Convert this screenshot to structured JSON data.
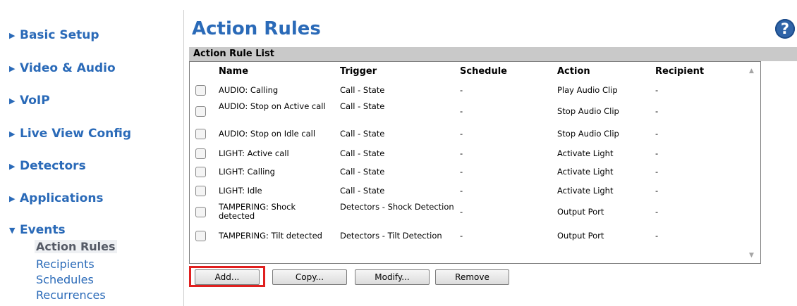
{
  "sidebar": {
    "items": [
      {
        "label": "Basic Setup"
      },
      {
        "label": "Video & Audio"
      },
      {
        "label": "VoIP"
      },
      {
        "label": "Live View Config"
      },
      {
        "label": "Detectors"
      },
      {
        "label": "Applications"
      },
      {
        "label": "Events"
      }
    ],
    "events_subitems": [
      {
        "label": "Action Rules",
        "active": true
      },
      {
        "label": "Recipients"
      },
      {
        "label": "Schedules"
      },
      {
        "label": "Recurrences"
      }
    ]
  },
  "page": {
    "title": "Action Rules",
    "help_icon": "?"
  },
  "list": {
    "header": "Action Rule List",
    "columns": [
      "Name",
      "Trigger",
      "Schedule",
      "Action",
      "Recipient"
    ],
    "rows": [
      {
        "name": "AUDIO: Calling",
        "trigger": "Call - State",
        "schedule": "-",
        "action": "Play Audio Clip",
        "recipient": "-"
      },
      {
        "name": "AUDIO: Stop on Active call",
        "trigger": "Call - State",
        "schedule": "-",
        "action": "Stop Audio Clip",
        "recipient": "-"
      },
      {
        "name": "AUDIO: Stop on Idle call",
        "trigger": "Call - State",
        "schedule": "-",
        "action": "Stop Audio Clip",
        "recipient": "-"
      },
      {
        "name": "LIGHT: Active call",
        "trigger": "Call - State",
        "schedule": "-",
        "action": "Activate Light",
        "recipient": "-"
      },
      {
        "name": "LIGHT: Calling",
        "trigger": "Call - State",
        "schedule": "-",
        "action": "Activate Light",
        "recipient": "-"
      },
      {
        "name": "LIGHT: Idle",
        "trigger": "Call - State",
        "schedule": "-",
        "action": "Activate Light",
        "recipient": "-"
      },
      {
        "name": "TAMPERING: Shock detected",
        "trigger": "Detectors - Shock Detection",
        "schedule": "-",
        "action": "Output Port",
        "recipient": "-"
      },
      {
        "name": "TAMPERING: Tilt detected",
        "trigger": "Detectors - Tilt Detection",
        "schedule": "-",
        "action": "Output Port",
        "recipient": "-"
      }
    ]
  },
  "buttons": {
    "add": "Add...",
    "copy": "Copy...",
    "modify": "Modify...",
    "remove": "Remove"
  },
  "colors": {
    "link": "#2a6ab8",
    "highlight": "#e0201f",
    "header_bg": "#c9c9c9"
  }
}
